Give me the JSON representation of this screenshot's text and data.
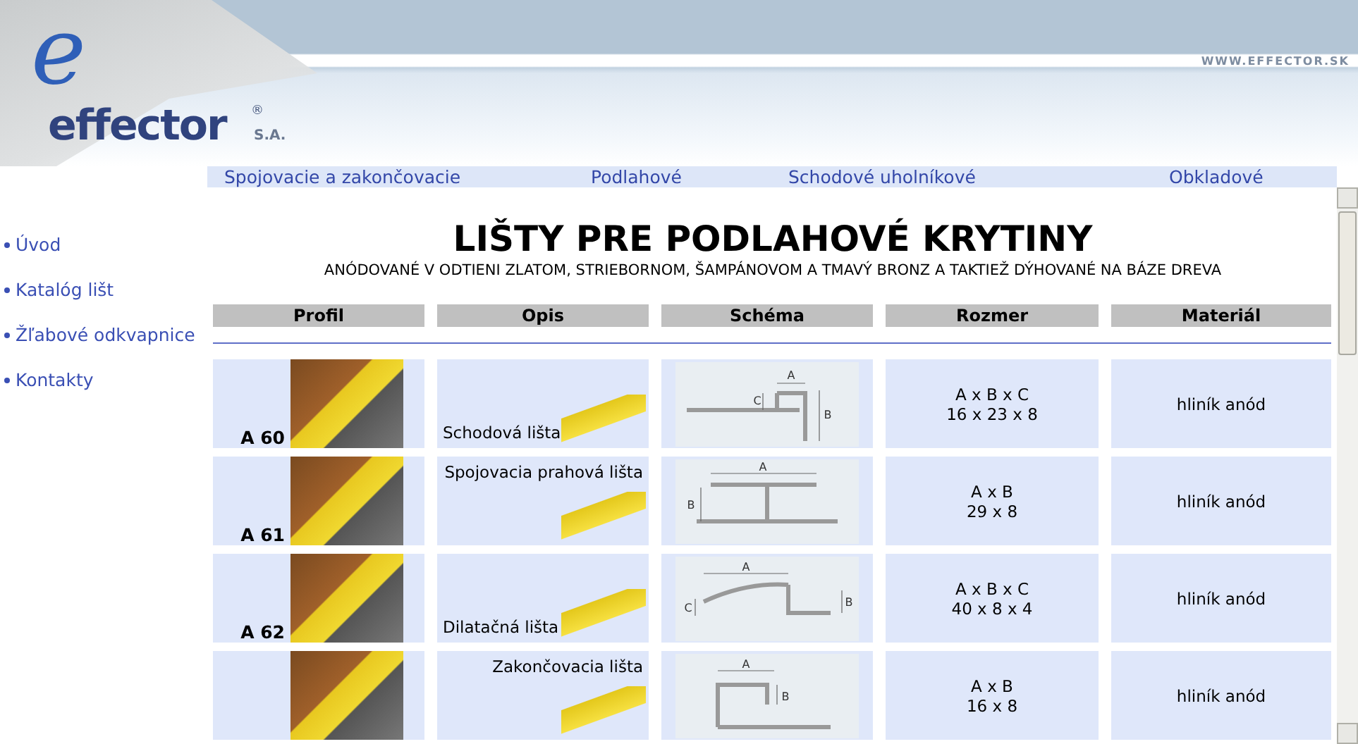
{
  "header": {
    "logo_mark": "e",
    "logo_name": "effector",
    "logo_registered": "®",
    "logo_suffix": "S.A.",
    "site_url": "WWW.EFFECTOR.SK"
  },
  "top_nav": [
    "Spojovacie a zakončovacie",
    "Podlahové",
    "Schodové uholníkové",
    "Obkladové"
  ],
  "sidebar": {
    "items": [
      "Úvod",
      "Katalóg lišt",
      "Žľabové odkvapnice",
      "Kontakty"
    ]
  },
  "page": {
    "title": "LIŠTY PRE PODLAHOVÉ KRYTINY",
    "subtitle": "ANÓDOVANÉ  V ODTIENI ZLATOM, STRIEBORNOM, ŠAMPÁNOVOM A TMAVÝ BRONZ A TAKTIEŽ DÝHOVANÉ NA BÁZE DREVA"
  },
  "table": {
    "columns": [
      "Profil",
      "Opis",
      "Schéma",
      "Rozmer",
      "Materiál"
    ],
    "rows": [
      {
        "profile": "A 60",
        "description": "Schodová lišta",
        "kind": "caption-below",
        "schema": {
          "kind": "stair",
          "labels": [
            "A",
            "B",
            "C"
          ]
        },
        "size_formula": "A x B x C",
        "size": "16 x 23 x 8",
        "material": "hliník anód"
      },
      {
        "profile": "A 61",
        "description": "Spojovacia prahová lišta",
        "kind": "caption-above",
        "schema": {
          "kind": "joint",
          "labels": [
            "A",
            "B"
          ]
        },
        "size_formula": "A x B",
        "size": "29 x 8",
        "material": "hliník anód"
      },
      {
        "profile": "A 62",
        "description": "Dilatačná lišta",
        "kind": "caption-below",
        "schema": {
          "kind": "expansion",
          "labels": [
            "A",
            "C",
            "B"
          ]
        },
        "size_formula": "A x B x C",
        "size": "40 x 8 x 4",
        "material": "hliník anód"
      },
      {
        "description": "Zakončovacia lišta",
        "kind": "caption-above",
        "schema": {
          "kind": "end",
          "labels": [
            "A",
            "B"
          ]
        },
        "size_formula": "A x B",
        "size": "16 x 8",
        "material": "hliník anód"
      }
    ]
  }
}
